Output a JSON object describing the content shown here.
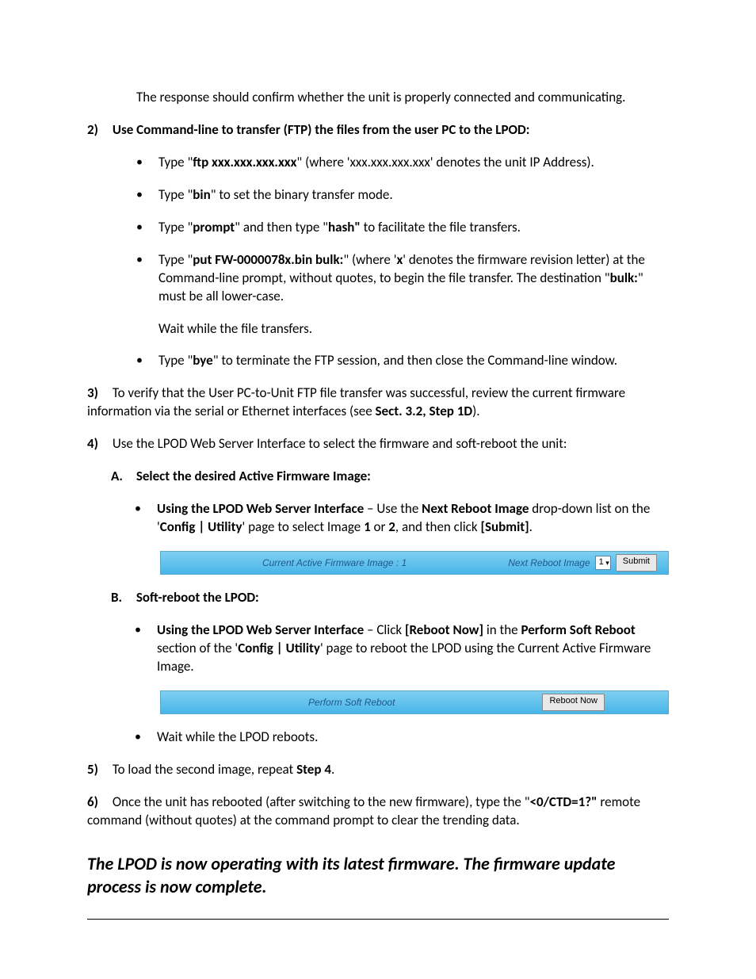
{
  "intro": "The response should confirm whether the unit is properly connected and communicating.",
  "steps": {
    "s2": {
      "num": "2)",
      "head": "Use Command-line to transfer (FTP) the files from the user PC to the LPOD:",
      "b1_pre": "Type \"",
      "b1_cmd": "ftp xxx.xxx.xxx.xxx",
      "b1_post": "\" (where 'xxx.xxx.xxx.xxx' denotes the unit IP Address).",
      "b2_pre": "Type \"",
      "b2_cmd": "bin",
      "b2_post": "\" to set the binary transfer mode.",
      "b3_pre": "Type \"",
      "b3_c1": "prompt",
      "b3_mid": "\" and then type \"",
      "b3_c2": "hash\"",
      "b3_post": " to facilitate the file transfers.",
      "b4_pre": "Type \"",
      "b4_cmd": "put FW-0000078x.bin bulk:",
      "b4_mid1": "\" (where '",
      "b4_x": "x",
      "b4_mid2": "' denotes the firmware revision letter) at the Command-line prompt, without quotes, to begin the file transfer. The destination \"",
      "b4_bulk": "bulk:",
      "b4_post": "\" must be all lower-case.",
      "b4_wait": "Wait while the file transfers.",
      "b5_pre": "Type \"",
      "b5_cmd": "bye",
      "b5_post": "\" to terminate the FTP session, and then close the Command-line window."
    },
    "s3": {
      "num": "3)",
      "t1": "To verify that the User PC-to-Unit FTP file transfer was successful, review the current firmware information via the serial or Ethernet interfaces (see ",
      "ref": "Sect. 3.2, Step 1D",
      "t2": ")."
    },
    "s4": {
      "num": "4)",
      "head": "Use the LPOD Web Server Interface to select the firmware and soft-reboot the unit:",
      "A": {
        "letter": "A.",
        "title": "Select the desired Active Firmware Image:",
        "b_pre": "Using the LPOD Web Server Interface",
        "b_t1": " – Use the ",
        "b_bold1": "Next Reboot Image",
        "b_t2": " drop-down list on the  '",
        "b_bold2": "Config | Utility",
        "b_t3": "' page to select Image ",
        "b_bold3": "1",
        "b_t4": " or ",
        "b_bold4": "2",
        "b_t5": ", and then click ",
        "b_bold5": "[Submit]",
        "b_t6": "."
      },
      "B": {
        "letter": "B.",
        "title": "Soft-reboot the LPOD:",
        "b_pre": "Using the LPOD Web Server Interface",
        "b_t1": " – Click ",
        "b_bold1": "[Reboot Now]",
        "b_t2": " in the ",
        "b_bold2": "Perform Soft Reboot",
        "b_t3": " section of the  '",
        "b_bold3": "Config | Utility",
        "b_t4": "' page to reboot the LPOD using the Current Active Firmware Image.",
        "b_wait": "Wait while the LPOD reboots."
      }
    },
    "s5": {
      "num": "5)",
      "t1": "To load the second image, repeat ",
      "ref": "Step 4",
      "t2": "."
    },
    "s6": {
      "num": "6)",
      "t1": "Once the unit has rebooted (after switching to the new firmware), type the \"",
      "cmd": "<0/CTD=1?\"",
      "t2": " remote command (without quotes) at the command prompt to clear the trending data."
    }
  },
  "ui1": {
    "left": "Current Active Firmware Image : 1",
    "rlabel": "Next Reboot Image",
    "sel": "1",
    "btn": "Submit"
  },
  "ui2": {
    "left": "Perform Soft Reboot",
    "btn": "Reboot Now"
  },
  "closing": "The LPOD is now operating with its latest firmware. The firmware update process is now complete."
}
